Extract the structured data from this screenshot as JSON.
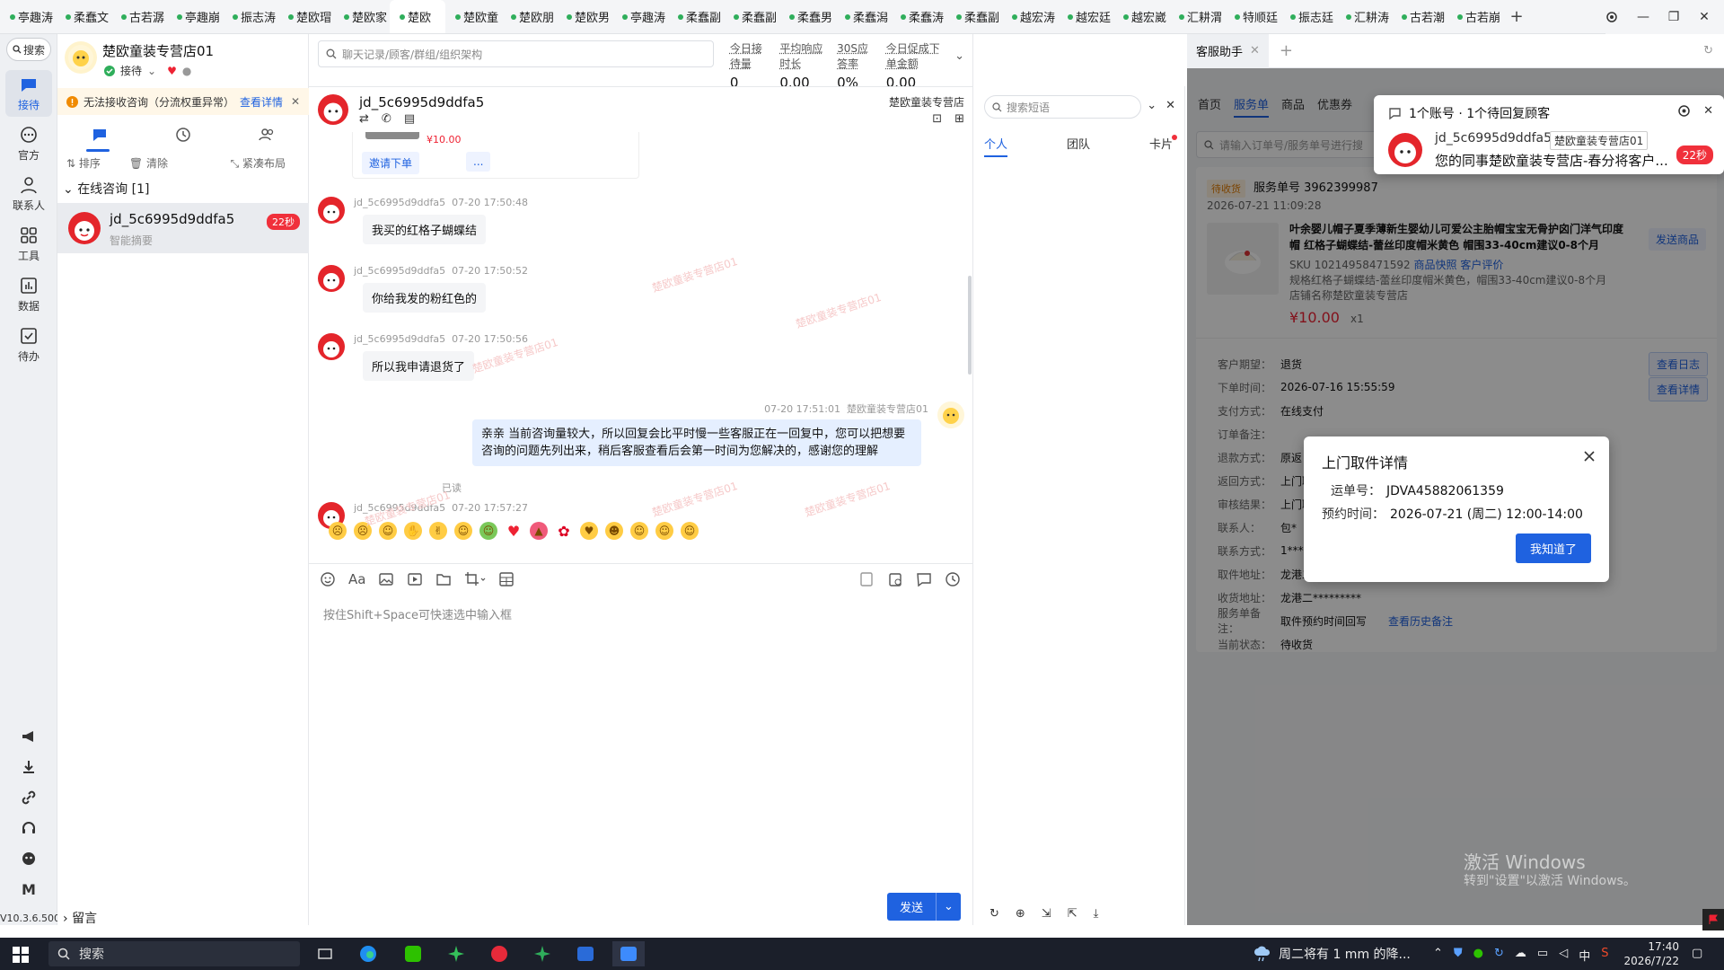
{
  "top_tabs": [
    "亭趣涛",
    "柔蠢文",
    "古若潺",
    "亭趣崩",
    "振志涛",
    "楚欧瑁",
    "楚欧家",
    "楚欧",
    "楚欧童",
    "楚欧朋",
    "楚欧男",
    "亭趣涛",
    "柔蠢副",
    "柔蠢副",
    "柔蠢男",
    "柔蠢潟",
    "柔蠢涛",
    "柔蠢副",
    "越宏涛",
    "越宏廷",
    "越宏崴",
    "汇耕渭",
    "特顺廷",
    "振志廷",
    "汇耕涛",
    "古若潮",
    "古若崩"
  ],
  "active_tab": 7,
  "rail": {
    "search": "搜索",
    "nav": [
      {
        "label": "接待",
        "icon": "chat-bubble-icon"
      },
      {
        "label": "官方",
        "icon": "message-icon"
      },
      {
        "label": "联系人",
        "icon": "person-icon"
      },
      {
        "label": "工具",
        "icon": "grid-icon"
      },
      {
        "label": "数据",
        "icon": "chart-icon"
      },
      {
        "label": "待办",
        "icon": "check-icon"
      }
    ],
    "bottom_icons": [
      "megaphone-icon",
      "download-icon",
      "link-icon",
      "headset-icon",
      "bot-icon",
      "m-logo-icon"
    ],
    "version": "V10.3.6.500"
  },
  "sidebar": {
    "shop_name": "楚欧童装专营店01",
    "status": "接待",
    "warning": "无法接收咨询（分流权重异常）",
    "warning_link": "查看详情",
    "tools": [
      "排序",
      "清除",
      "紧凑布局"
    ],
    "group": "在线咨询 [1]",
    "conversation": {
      "name": "jd_5c6995d9ddfa5",
      "sub": "智能摘要",
      "badge": "22秒"
    },
    "leave": "留言"
  },
  "chat": {
    "search_placeholder": "聊天记录/顾客/群组/组织架构",
    "stats": [
      {
        "label": "今日接待量",
        "value": "0"
      },
      {
        "label": "平均响应时长",
        "value": "0.00"
      },
      {
        "label": "30S应答率",
        "value": "0%"
      },
      {
        "label": "今日促成下单金额",
        "value": "0.00"
      }
    ],
    "customer": "jd_5c6995d9ddfa5",
    "shop": "楚欧童装专营店",
    "card_price": "¥10.00",
    "card_button": "邀请下单",
    "card_more": "...",
    "messages": [
      {
        "sender": "jd_5c6995d9ddfa5",
        "time": "07-20 17:50:48",
        "text": "我买的红格子蝴蝶结"
      },
      {
        "sender": "jd_5c6995d9ddfa5",
        "time": "07-20 17:50:52",
        "text": "你给我发的粉红色的"
      },
      {
        "sender": "jd_5c6995d9ddfa5",
        "time": "07-20 17:50:56",
        "text": "所以我申请退货了"
      }
    ],
    "my_message": {
      "time": "07-20 17:51:01",
      "sender": "楚欧童装专营店01",
      "text": "亲亲  当前咨询量较大，所以回复会比平时慢一些客服正在一回复中，您可以把想要咨询的问题先列出来，稍后客服查看后会第一时间为您解决的，感谢您的理解",
      "read": "已读"
    },
    "emoji_message": {
      "sender": "jd_5c6995d9ddfa5",
      "time": "07-20 17:57:27"
    },
    "watermark": "楚欧童装专营店01",
    "composer_placeholder": "按住Shift+Space可快速选中输入框",
    "send": "发送"
  },
  "quick": {
    "search_placeholder": "搜索短语",
    "tabs": [
      "个人",
      "团队",
      "卡片"
    ]
  },
  "right": {
    "tab": "客服助手",
    "nav": [
      "首页",
      "服务单",
      "商品",
      "优惠券"
    ],
    "search_placeholder": "请输入订单号/服务单号进行搜",
    "card": {
      "status": "待收货",
      "service_no": "服务单号 3962399987",
      "time": "2026-07-21 11:09:28",
      "title": "叶余婴儿帽子夏季薄新生婴幼儿可爱公主胎帽宝宝无骨护囟门洋气印度帽 红格子蝴蝶结-蕾丝印度帽米黄色 帽围33-40cm建议0-8个月",
      "sku": "SKU 10214958471592",
      "sku_links": [
        "商品快照",
        "客户评价"
      ],
      "spec": "规格红格子蝴蝶结-蕾丝印度帽米黄色，帽围33-40cm建议0-8个月",
      "store": "店铺名称楚欧童装专营店",
      "price": "¥10.00",
      "qty": "x1",
      "send_product": "发送商品",
      "view_log": "查看日志",
      "view_detail": "查看详情",
      "rows": [
        {
          "k": "客户期望：",
          "v": "退货"
        },
        {
          "k": "下单时间：",
          "v": "2026-07-16 15:55:59"
        },
        {
          "k": "支付方式：",
          "v": "在线支付"
        },
        {
          "k": "订单备注：",
          "v": ""
        },
        {
          "k": "退款方式：",
          "v": "原返"
        },
        {
          "k": "返回方式：",
          "v": "上门取"
        },
        {
          "k": "审核结果：",
          "v": "上门取"
        },
        {
          "k": "联系人：",
          "v": "包*"
        },
        {
          "k": "联系方式：",
          "v": "1****"
        },
        {
          "k": "取件地址：",
          "v": "龙港二"
        },
        {
          "k": "收货地址：",
          "v": "龙港二*********"
        },
        {
          "k": "服务单备注：",
          "v": "取件预约时间回写"
        },
        {
          "k": "当前状态：",
          "v": "待收货"
        }
      ],
      "history_link": "查看历史备注"
    }
  },
  "notification": {
    "title": "1个账号 · 1个待回复顾客",
    "name": "jd_5c6995d9ddfa5",
    "tag": "楚欧童装专营店01",
    "message": "您的同事楚欧童装专营店-春分将客户...",
    "badge": "22秒"
  },
  "modal": {
    "title": "上门取件详情",
    "waybill_label": "运单号：",
    "waybill": "JDVA45882061359",
    "appt_label": "预约时间：",
    "appt": "2026-07-21 (周二) 12:00-14:00",
    "ok": "我知道了"
  },
  "activate": {
    "line1": "激活 Windows",
    "line2": "转到\"设置\"以激活 Windows。"
  },
  "taskbar": {
    "search": "搜索",
    "weather": "周二将有 1 mm 的降...",
    "ime": "中",
    "time": "17:40",
    "date": "2026/7/22"
  },
  "colors": {
    "accent": "#1f62e0",
    "badge": "#f0303b",
    "warning_bg": "#fff7e8"
  }
}
